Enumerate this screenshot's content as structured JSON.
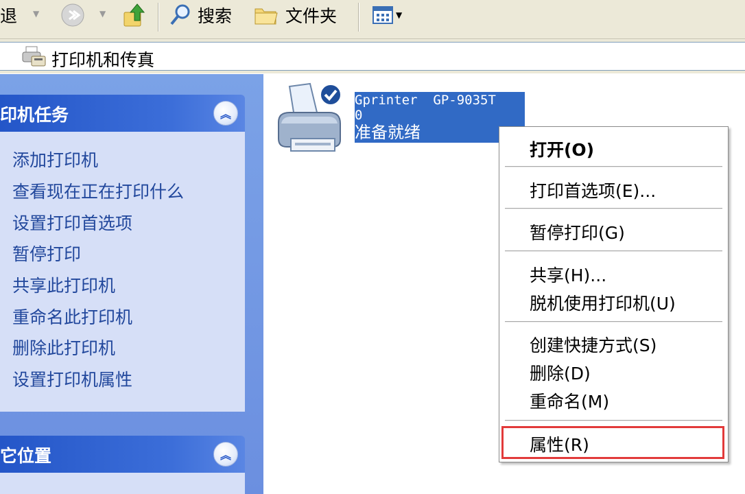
{
  "toolbar": {
    "back_label": "退",
    "search_label": "搜索",
    "folders_label": "文件夹"
  },
  "address": {
    "path": "打印机和传真"
  },
  "left_pane": {
    "printer_tasks": {
      "title": "印机任务",
      "items": [
        {
          "label": "添加打印机"
        },
        {
          "label": "查看现在正在打印什么"
        },
        {
          "label": "设置打印首选项"
        },
        {
          "label": "暂停打印"
        },
        {
          "label": "共享此打印机"
        },
        {
          "label": "重命名此打印机"
        },
        {
          "label": "删除此打印机"
        },
        {
          "label": "设置打印机属性"
        }
      ]
    },
    "other_places": {
      "title": "它位置"
    }
  },
  "printer": {
    "name": "Gprinter  GP-9035T",
    "jobs": "0",
    "status": "准备就绪"
  },
  "context_menu": {
    "items": [
      {
        "label": "打开(O)"
      },
      {
        "label": "打印首选项(E)..."
      },
      {
        "label": "暂停打印(G)"
      },
      {
        "label": "共享(H)..."
      },
      {
        "label": "脱机使用打印机(U)"
      },
      {
        "label": "创建快捷方式(S)"
      },
      {
        "label": "删除(D)"
      },
      {
        "label": "重命名(M)"
      },
      {
        "label": "属性(R)"
      }
    ]
  },
  "colors": {
    "pane_header": "#2456c8",
    "pane_body": "#d6dff7",
    "selection": "#316ac5",
    "highlight_box": "#e23a3a"
  }
}
